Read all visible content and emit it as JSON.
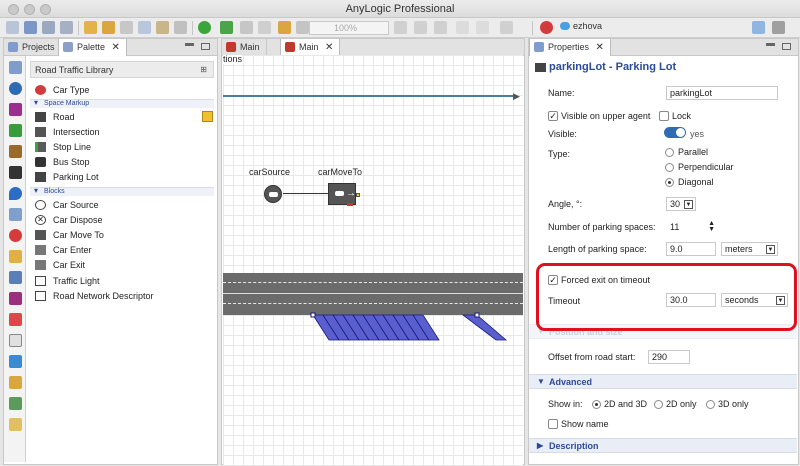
{
  "window": {
    "title": "AnyLogic Professional"
  },
  "toolbar": {
    "zoom": "100%",
    "user": "ezhova"
  },
  "left_panel": {
    "tabs": [
      {
        "label": "Projects"
      },
      {
        "label": "Palette"
      }
    ],
    "library": "Road Traffic Library",
    "top_items": [
      {
        "label": "Car Type",
        "icon": "car-type-icon"
      }
    ],
    "space_markup": {
      "label": "Space Markup",
      "items": [
        {
          "label": "Road",
          "icon": "road-icon"
        },
        {
          "label": "Intersection",
          "icon": "intersection-icon"
        },
        {
          "label": "Stop Line",
          "icon": "stop-line-icon"
        },
        {
          "label": "Bus Stop",
          "icon": "bus-stop-icon"
        },
        {
          "label": "Parking Lot",
          "icon": "parking-lot-icon"
        }
      ]
    },
    "blocks": {
      "label": "Blocks",
      "items": [
        {
          "label": "Car Source",
          "icon": "car-source-icon"
        },
        {
          "label": "Car Dispose",
          "icon": "car-dispose-icon"
        },
        {
          "label": "Car Move To",
          "icon": "car-move-to-icon"
        },
        {
          "label": "Car Enter",
          "icon": "car-enter-icon"
        },
        {
          "label": "Car Exit",
          "icon": "car-exit-icon"
        },
        {
          "label": "Traffic Light",
          "icon": "traffic-light-icon"
        },
        {
          "label": "Road Network Descriptor",
          "icon": "road-network-icon"
        }
      ]
    }
  },
  "editor": {
    "tabs": [
      {
        "label": "Main"
      },
      {
        "label": "Main"
      }
    ],
    "canvas_fragment": "tions",
    "blocks": [
      {
        "label": "carSource"
      },
      {
        "label": "carMoveTo"
      }
    ]
  },
  "properties": {
    "tab": "Properties",
    "header": "parkingLot - Parking Lot",
    "name_label": "Name:",
    "name_value": "parkingLot",
    "visible_upper_label": "Visible on upper agent",
    "lock_label": "Lock",
    "visible_label": "Visible:",
    "visible_value": "yes",
    "type_label": "Type:",
    "type_options": [
      {
        "label": "Parallel",
        "selected": false
      },
      {
        "label": "Perpendicular",
        "selected": false
      },
      {
        "label": "Diagonal",
        "selected": true
      }
    ],
    "angle_label": "Angle, °:",
    "angle_value": "30",
    "spaces_label": "Number of parking spaces:",
    "spaces_value": "11",
    "length_label": "Length of parking space:",
    "length_value": "9.0",
    "length_unit": "meters",
    "forced_exit_label": "Forced exit on timeout",
    "timeout_label": "Timeout",
    "timeout_value": "30.0",
    "timeout_unit": "seconds",
    "hidden_section": "Position and size",
    "offset_label": "Offset from road start:",
    "offset_value": "290",
    "advanced_label": "Advanced",
    "show_in_label": "Show in:",
    "show_in_options": [
      {
        "label": "2D and 3D",
        "selected": true
      },
      {
        "label": "2D only",
        "selected": false
      },
      {
        "label": "3D only",
        "selected": false
      }
    ],
    "show_name_label": "Show name",
    "description_label": "Description"
  },
  "colors": {
    "highlight": "#e01020",
    "road": "#6b6b6b",
    "parking": "#5a5fd0"
  }
}
